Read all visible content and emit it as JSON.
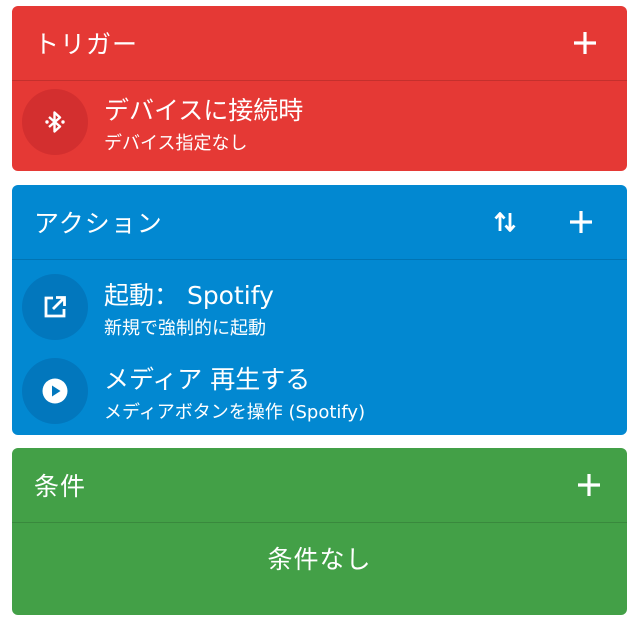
{
  "trigger": {
    "title": "トリガー",
    "items": [
      {
        "icon": "bluetooth-icon",
        "title": "デバイスに接続時",
        "subtitle": "デバイス指定なし"
      }
    ]
  },
  "action": {
    "title": "アクション",
    "items": [
      {
        "icon": "open-in-new-icon",
        "title": "起動： Spotify",
        "subtitle": "新規で強制的に起動"
      },
      {
        "icon": "play-icon",
        "title": "メディア 再生する",
        "subtitle": "メディアボタンを操作 (Spotify)"
      }
    ]
  },
  "condition": {
    "title": "条件",
    "empty_text": "条件なし"
  },
  "colors": {
    "trigger": "#e53935",
    "action": "#0288d1",
    "condition": "#43a047"
  }
}
